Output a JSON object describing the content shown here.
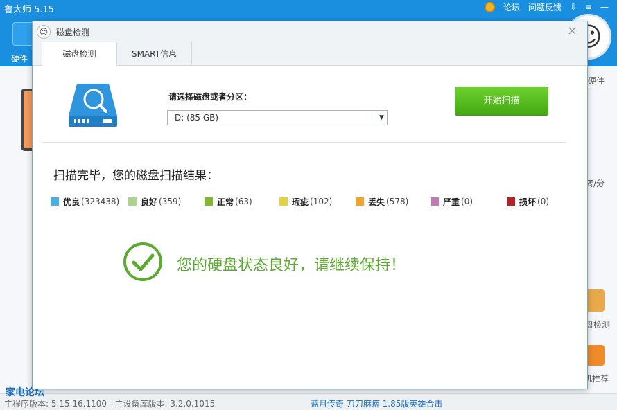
{
  "app": {
    "title": "鲁大师 5.15",
    "top_links": {
      "forum": "论坛",
      "feedback": "问题反馈"
    },
    "nav": {
      "hardware_label": "硬件"
    },
    "right_labels": {
      "hardware": "硬件",
      "speed": "转/分",
      "disk_check": "盘检测",
      "recommend": "机推荐"
    }
  },
  "status_bar": {
    "main_version": "主程序版本: 5.15.16.1100",
    "db_version": "主设备库版本: 3.2.0.1015",
    "ad": "蓝月传奇 刀刀麻痹 1.85版英雄合击",
    "logo": "家电论坛"
  },
  "dialog": {
    "title": "磁盘检测",
    "close": "×",
    "tabs": [
      {
        "label": "磁盘检测",
        "active": true
      },
      {
        "label": "SMART信息",
        "active": false
      }
    ],
    "select_label": "请选择磁盘或者分区：",
    "selected_disk": "D:  (85 GB)",
    "scan_button": "开始扫描",
    "result_title": "扫描完毕，您的磁盘扫描结果：",
    "legend": [
      {
        "name": "优良",
        "count": "(323438)",
        "color": "#4aaee6"
      },
      {
        "name": "良好",
        "count": "(359)",
        "color": "#a8d68a"
      },
      {
        "name": "正常",
        "count": "(63)",
        "color": "#7fba2e"
      },
      {
        "name": "瑕疵",
        "count": "(102)",
        "color": "#e3d23a"
      },
      {
        "name": "丢失",
        "count": "(578)",
        "color": "#f0a42a"
      },
      {
        "name": "严重",
        "count": "(0)",
        "color": "#c07ab8"
      },
      {
        "name": "损坏",
        "count": "(0)",
        "color": "#b52126"
      }
    ],
    "message": "您的硬盘状态良好，请继续保持！"
  }
}
